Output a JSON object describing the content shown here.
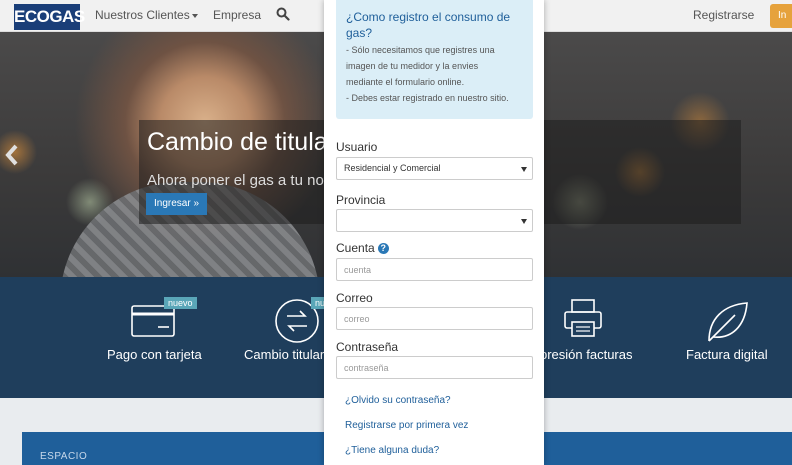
{
  "navbar": {
    "logo": "ECOGAS",
    "clientes": "Nuestros Clientes",
    "empresa": "Empresa",
    "registrarse": "Registrarse",
    "ingresar": "In"
  },
  "hero": {
    "title": "Cambio de titular",
    "subtitle": "Ahora poner el gas a tu nom",
    "button": "Ingresar »"
  },
  "features": [
    {
      "label": "Pago con tarjeta",
      "badge": "nuevo",
      "icon": "credit-card-icon"
    },
    {
      "label": "Cambio titular",
      "badge": "nu",
      "icon": "exchange-arrows-icon"
    },
    {
      "label": "presión facturas",
      "icon": "printer-icon"
    },
    {
      "label": "Factura digital",
      "icon": "leaf-icon"
    }
  ],
  "bottom": {
    "label": "ESPACIO"
  },
  "modal": {
    "info_title": "¿Como registro el consumo de gas?",
    "info_lines": [
      "- Sólo necesitamos que registres una",
      "imagen de tu medidor y la envies",
      "mediante el formulario online.",
      "- Debes estar registrado en nuestro sitio."
    ],
    "usuario_label": "Usuario",
    "usuario_value": "Residencial y Comercial",
    "provincia_label": "Provincia",
    "provincia_value": "",
    "cuenta_label": "Cuenta",
    "cuenta_placeholder": "cuenta",
    "correo_label": "Correo",
    "correo_placeholder": "correo",
    "password_label": "Contraseña",
    "password_placeholder": "contraseña",
    "links": {
      "forgot": "¿Olvido su contraseña?",
      "register": "Registrarse por primera vez",
      "doubt": "¿Tiene alguna duda?"
    }
  },
  "colors": {
    "brand": "#1a3e78",
    "accent": "#e6a23c",
    "link": "#1f5f9a",
    "info_bg": "#dbeef7",
    "feature_band": "#1f3e5c"
  }
}
